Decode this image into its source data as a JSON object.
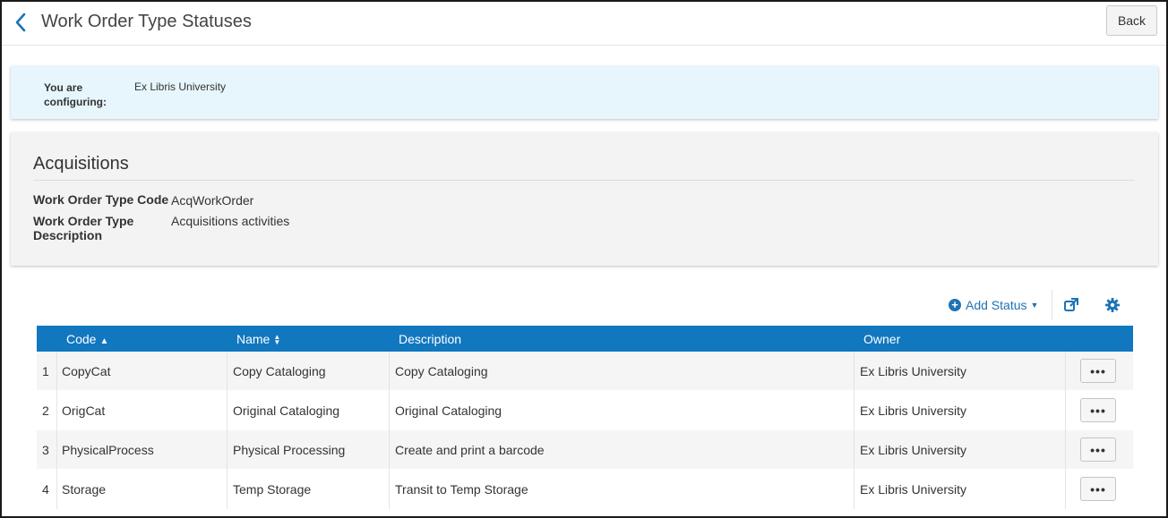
{
  "header": {
    "title": "Work Order Type Statuses",
    "back_label": "Back"
  },
  "config": {
    "label": "You are configuring:",
    "value": "Ex Libris University"
  },
  "info": {
    "title": "Acquisitions",
    "code_label": "Work Order Type Code",
    "code_value": "AcqWorkOrder",
    "desc_label": "Work Order Type Description",
    "desc_value": "Acquisitions activities"
  },
  "toolbar": {
    "add_label": "Add Status",
    "icons": [
      "plus-circle-icon",
      "caret-down-icon",
      "export-icon",
      "gear-icon"
    ]
  },
  "table": {
    "columns": [
      {
        "label": "Code",
        "sort": "▲"
      },
      {
        "label": "Name",
        "sort": "▲▼"
      },
      {
        "label": "Description",
        "sort": ""
      },
      {
        "label": "Owner",
        "sort": ""
      }
    ],
    "rows": [
      {
        "num": "1",
        "code": "CopyCat",
        "name": "Copy Cataloging",
        "description": "Copy Cataloging",
        "owner": "Ex Libris University",
        "actions": "•••"
      },
      {
        "num": "2",
        "code": "OrigCat",
        "name": "Original Cataloging",
        "description": "Original Cataloging",
        "owner": "Ex Libris University",
        "actions": "•••"
      },
      {
        "num": "3",
        "code": "PhysicalProcess",
        "name": "Physical Processing",
        "description": "Create and print a barcode",
        "owner": "Ex Libris University",
        "actions": "•••"
      },
      {
        "num": "4",
        "code": "Storage",
        "name": "Temp Storage",
        "description": "Transit to Temp Storage",
        "owner": "Ex Libris University",
        "actions": "•••"
      }
    ]
  },
  "colors": {
    "accent": "#1d73b5",
    "table_header": "#1177bf",
    "banner_bg": "#e6f6fc",
    "panel_bg": "#f3f3f3"
  }
}
